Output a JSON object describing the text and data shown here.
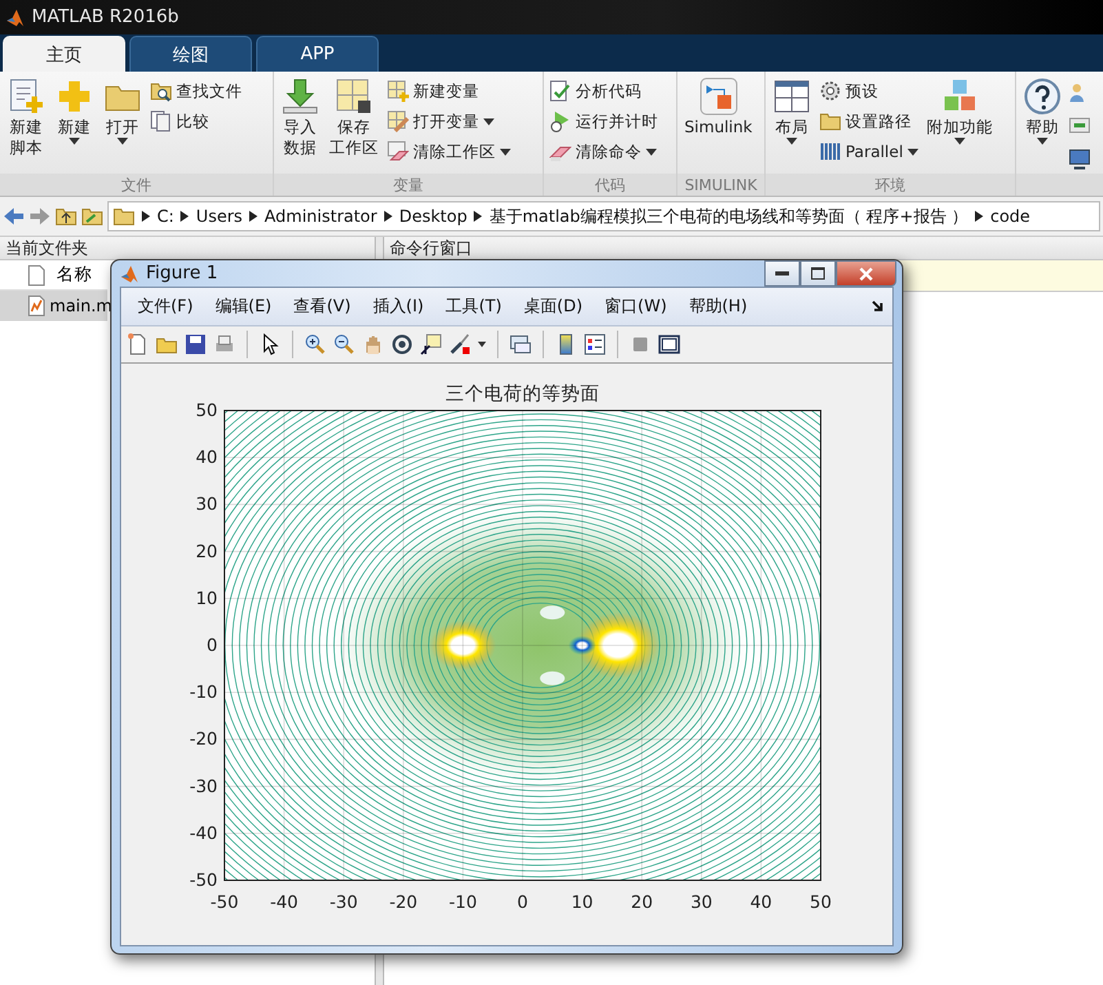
{
  "window": {
    "title": "MATLAB R2016b"
  },
  "tabs": [
    {
      "label": "主页",
      "selected": true
    },
    {
      "label": "绘图",
      "selected": false
    },
    {
      "label": "APP",
      "selected": false
    }
  ],
  "toolstrip": {
    "groups": [
      {
        "title": "文件",
        "items": [
          {
            "kind": "large",
            "lines": [
              "新建",
              "脚本"
            ],
            "dropdown": false
          },
          {
            "kind": "large",
            "lines": [
              "新建"
            ],
            "dropdown": true
          },
          {
            "kind": "large",
            "lines": [
              "打开"
            ],
            "dropdown": true
          },
          {
            "kind": "stack",
            "entries": [
              {
                "label": "查找文件",
                "dropdown": false
              },
              {
                "label": "比较",
                "dropdown": false
              }
            ]
          }
        ]
      },
      {
        "title": "变量",
        "items": [
          {
            "kind": "large",
            "lines": [
              "导入",
              "数据"
            ],
            "dropdown": false
          },
          {
            "kind": "large",
            "lines": [
              "保存",
              "工作区"
            ],
            "dropdown": false
          },
          {
            "kind": "stack",
            "entries": [
              {
                "label": "新建变量",
                "dropdown": false
              },
              {
                "label": "打开变量",
                "dropdown": true
              },
              {
                "label": "清除工作区",
                "dropdown": true
              }
            ]
          }
        ]
      },
      {
        "title": "代码",
        "items": [
          {
            "kind": "stack",
            "entries": [
              {
                "label": "分析代码",
                "dropdown": false
              },
              {
                "label": "运行并计时",
                "dropdown": false
              },
              {
                "label": "清除命令",
                "dropdown": true
              }
            ]
          }
        ]
      },
      {
        "title": "SIMULINK",
        "items": [
          {
            "kind": "large",
            "lines": [
              "Simulink"
            ],
            "dropdown": false
          }
        ]
      },
      {
        "title": "环境",
        "items": [
          {
            "kind": "large",
            "lines": [
              "布局"
            ],
            "dropdown": true
          },
          {
            "kind": "stack",
            "entries": [
              {
                "label": "预设",
                "dropdown": false
              },
              {
                "label": "设置路径",
                "dropdown": false
              },
              {
                "label": "Parallel",
                "dropdown": true
              }
            ]
          },
          {
            "kind": "large",
            "lines": [
              "附加功能"
            ],
            "dropdown": true
          }
        ]
      },
      {
        "items": [
          {
            "kind": "large",
            "lines": [
              "帮助"
            ],
            "dropdown": true
          }
        ]
      }
    ]
  },
  "address_bar": {
    "segments": [
      "C:",
      "Users",
      "Administrator",
      "Desktop",
      "基于matlab编程模拟三个电荷的电场线和等势面（ 程序+报告 ）",
      "code"
    ]
  },
  "current_folder": {
    "title": "当前文件夹",
    "column": "名称",
    "files": [
      {
        "name": "main.m",
        "selected": true
      }
    ]
  },
  "command_window": {
    "title": "命令行窗口"
  },
  "figure": {
    "title": "Figure 1",
    "menus": [
      "文件(F)",
      "编辑(E)",
      "查看(V)",
      "插入(I)",
      "工具(T)",
      "桌面(D)",
      "窗口(W)",
      "帮助(H)"
    ],
    "axes": {
      "title": "三个电荷的等势面",
      "xticks": [
        "-50",
        "-40",
        "-30",
        "-20",
        "-10",
        "0",
        "10",
        "20",
        "30",
        "40",
        "50"
      ],
      "yticks": [
        "50",
        "40",
        "30",
        "20",
        "10",
        "0",
        "-10",
        "-20",
        "-30",
        "-40",
        "-50"
      ]
    }
  }
}
